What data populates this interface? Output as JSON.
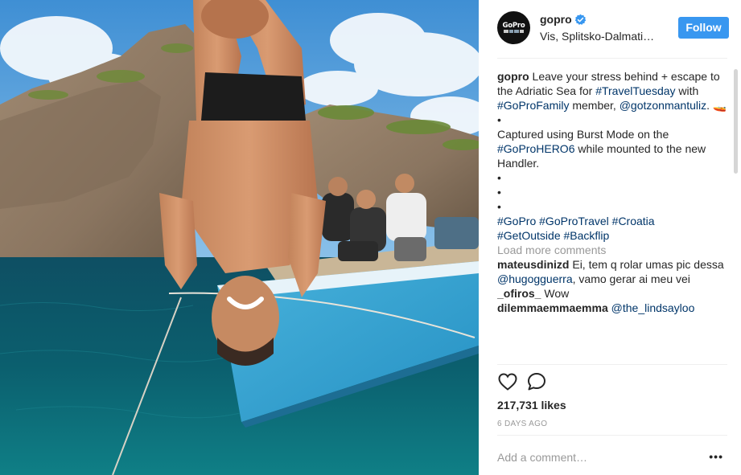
{
  "post": {
    "image_alt": "Person doing a backflip off a blue boat with friends watching, Adriatic Sea cliffs",
    "username": "gopro",
    "verified": true,
    "location": "Vis, Splitsko-Dalmati…",
    "follow_label": "Follow",
    "avatar_text": "GoPro",
    "caption": {
      "username": "gopro",
      "part1": " Leave your stress behind + escape to the Adriatic Sea for ",
      "tag_traveltuesday": "#TravelTuesday",
      "part2": " with ",
      "tag_goprofamily": "#GoProFamily",
      "part3": " member, ",
      "mention": "@gotzonmantuliz",
      "part4": ". 🚤",
      "bullet": "•",
      "part5": "Captured using Burst Mode on the ",
      "tag_hero6": "#GoProHERO6",
      "part6": " while mounted to the new Handler.",
      "tags": [
        "#GoPro",
        "#GoProTravel",
        "#Croatia",
        "#GetOutside",
        "#Backflip"
      ]
    },
    "load_more": "Load more comments",
    "comments": [
      {
        "user": "mateusdinizd",
        "text_a": " Ei, tem q rolar umas pic dessa ",
        "mention": "@hugogguerra",
        "text_b": ", vamo gerar ai meu vei"
      },
      {
        "user": "_ofiros_",
        "text_a": " Wow"
      },
      {
        "user": "dilemmaemmaemma",
        "text_a": " ",
        "mention": "@the_lindsayloo"
      }
    ],
    "likes": "217,731 likes",
    "time": "6 DAYS AGO",
    "comment_placeholder": "Add a comment…",
    "more_label": "•••",
    "icons": {
      "like": "heart-icon",
      "comment": "comment-icon"
    }
  }
}
